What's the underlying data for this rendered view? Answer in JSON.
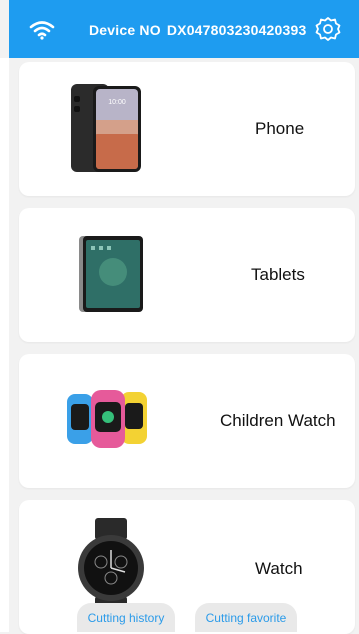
{
  "header": {
    "device_label": "Device NO",
    "device_number": "DX047803230420393",
    "wifi_icon": "wifi-icon",
    "settings_icon": "gear-icon",
    "bg_color": "#1e9cf0"
  },
  "categories": [
    {
      "label": "Phone",
      "icon": "phone-image"
    },
    {
      "label": "Tablets",
      "icon": "tablet-image"
    },
    {
      "label": "Children Watch",
      "icon": "children-watch-image"
    },
    {
      "label": "Watch",
      "icon": "smartwatch-image"
    }
  ],
  "bottom_tabs": [
    {
      "label": "Cutting history"
    },
    {
      "label": "Cutting favorite"
    }
  ]
}
